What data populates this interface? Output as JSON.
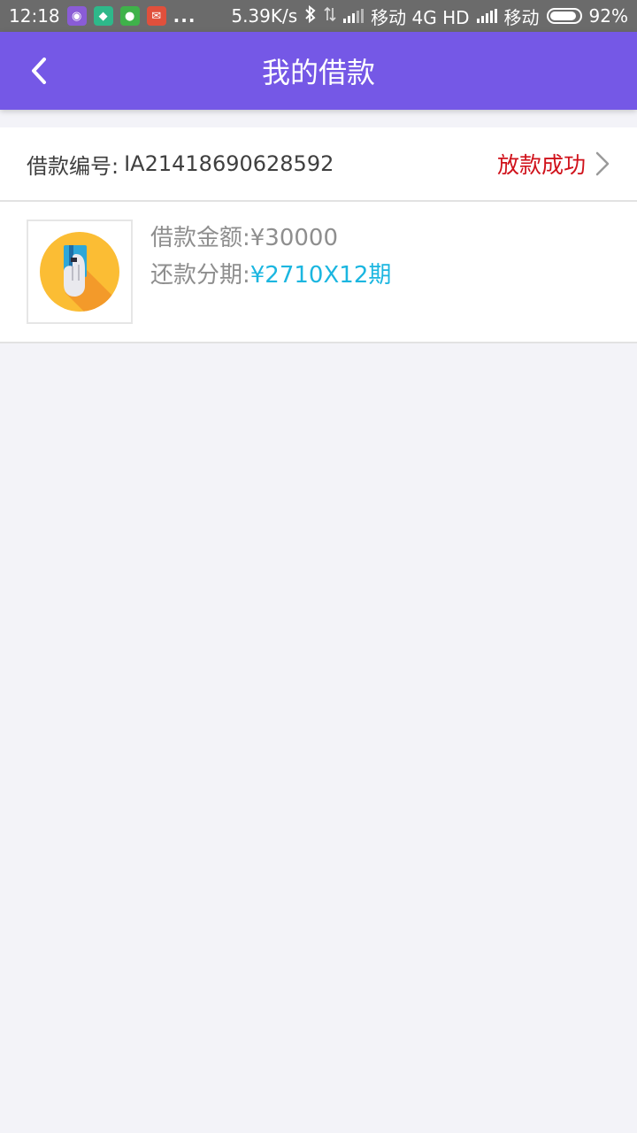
{
  "status_bar": {
    "time": "12:18",
    "dots": "...",
    "speed": "5.39K/s",
    "carrier1": "移动 4G HD",
    "carrier2": "移动",
    "battery": "92%"
  },
  "header": {
    "title": "我的借款"
  },
  "loan": {
    "number_label": "借款编号:",
    "number_value": "IA21418690628592",
    "status": "放款成功",
    "amount_label": "借款金额:",
    "amount_value": "¥30000",
    "installment_label": "还款分期:",
    "installment_value": "¥2710X12期"
  },
  "colors": {
    "header_bg": "#7558e6",
    "status_red": "#d0121b",
    "installment_blue": "#1bb6e0",
    "page_bg": "#f3f3f8"
  },
  "icons": {
    "back": "chevron-left-icon",
    "status_arrow": "chevron-right-icon",
    "loan_thumb": "card-hand-icon"
  }
}
